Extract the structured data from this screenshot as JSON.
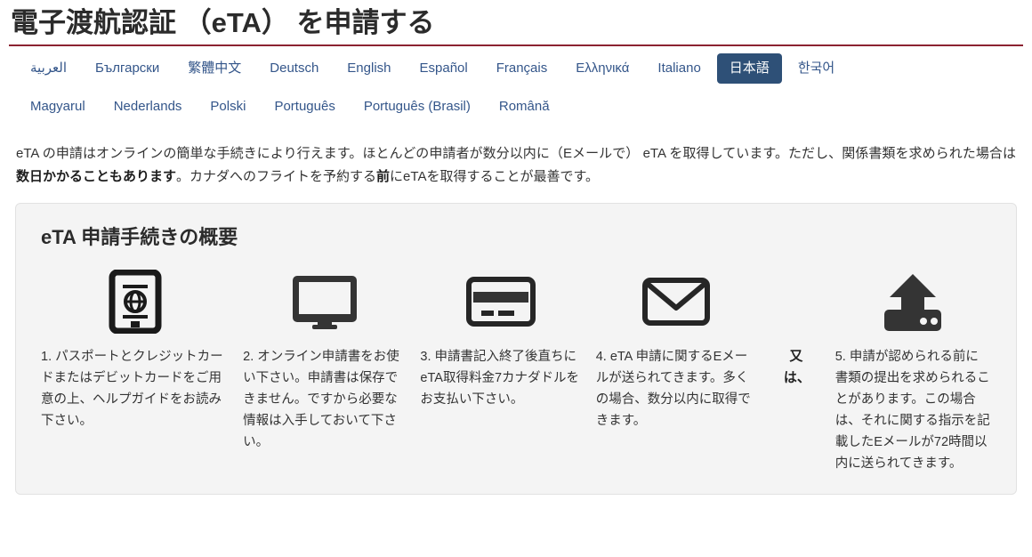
{
  "header": {
    "title": "電子渡航認証 （eTA） を申請する",
    "rule_color": "#8c2231"
  },
  "language_nav": {
    "active_bg": "#2e5077",
    "link_color": "#34568a",
    "row1": [
      {
        "label": "العربية",
        "active": false
      },
      {
        "label": "Български",
        "active": false
      },
      {
        "label": "繁體中文",
        "active": false
      },
      {
        "label": "Deutsch",
        "active": false
      },
      {
        "label": "English",
        "active": false
      },
      {
        "label": "Español",
        "active": false
      },
      {
        "label": "Français",
        "active": false
      },
      {
        "label": "Ελληνικά",
        "active": false
      },
      {
        "label": "Italiano",
        "active": false
      },
      {
        "label": "日本語",
        "active": true
      },
      {
        "label": "한국어",
        "active": false
      }
    ],
    "row2": [
      {
        "label": "Magyarul",
        "active": false
      },
      {
        "label": "Nederlands",
        "active": false
      },
      {
        "label": "Polski",
        "active": false
      },
      {
        "label": "Português",
        "active": false
      },
      {
        "label": "Português (Brasil)",
        "active": false
      },
      {
        "label": "Română",
        "active": false
      }
    ]
  },
  "intro": {
    "part1": "eTA の申請はオンラインの簡単な手続きにより行えます。ほとんどの申請者が数分以内に（Eメールで） eTA を取得しています。ただし、関係書類を求められた場合は",
    "bold1": "数日かかることもあります",
    "part2": "。カナダへのフライトを予約する",
    "bold2": "前",
    "part3": "にeTAを取得することが最善です。"
  },
  "panel": {
    "title": "eTA 申請手続きの概要",
    "or_label": "又は、",
    "steps": [
      {
        "icon": "passport-icon",
        "text": "1. パスポートとクレジットカードまたはデビットカードをご用意の上、ヘルプガイドをお読み下さい。"
      },
      {
        "icon": "monitor-icon",
        "text": "2. オンライン申請書をお使い下さい。申請書は保存できません。ですから必要な情報は入手しておいて下さい。"
      },
      {
        "icon": "credit-card-icon",
        "text": "3. 申請書記入終了後直ちにeTA取得料金7カナダドルをお支払い下さい。"
      },
      {
        "icon": "envelope-icon",
        "text": "4. eTA 申請に関するEメールが送られてきます。多くの場合、数分以内に取得できます。"
      },
      {
        "icon": "upload-icon",
        "text": "5. 申請が認められる前に書類の提出を求められることがあります。この場合は、それに関する指示を記載したEメールが72時間以内に送られてきます。"
      }
    ]
  }
}
